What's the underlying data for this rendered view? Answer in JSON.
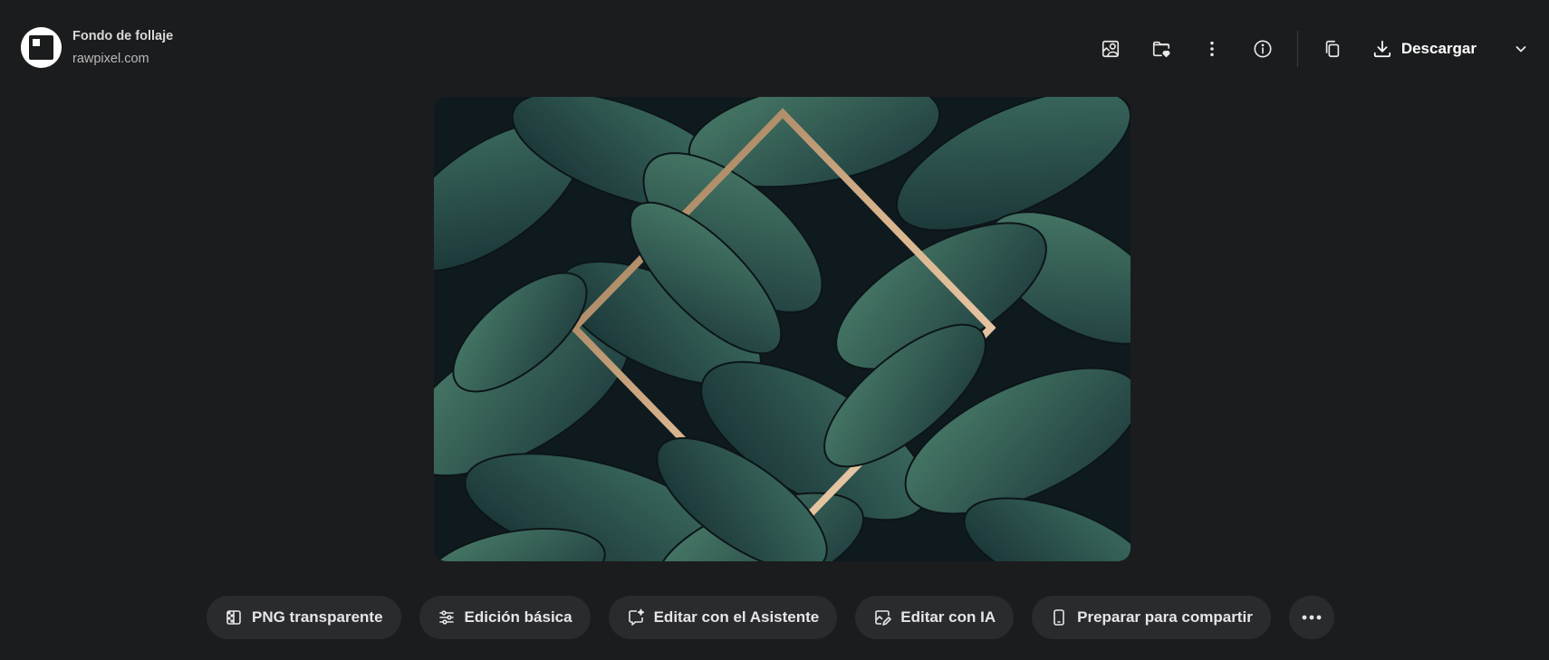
{
  "header": {
    "title": "Fondo de follaje",
    "source": "rawpixel.com",
    "download_label": "Descargar",
    "icons": [
      "user-image-icon",
      "folder-heart-icon",
      "more-vertical-icon",
      "info-icon",
      "copy-icon",
      "download-icon",
      "chevron-down-icon"
    ]
  },
  "preview": {
    "colors": {
      "background": "#0f1a1f",
      "leaf_dark": "#1d3a3c",
      "leaf_mid": "#2e5a55",
      "leaf_light": "#4a7d6a",
      "frame_gold": "#c9a47c"
    }
  },
  "actions": {
    "items": [
      {
        "label": "PNG transparente",
        "icon": "transparent-png-icon"
      },
      {
        "label": "Edición básica",
        "icon": "sliders-icon"
      },
      {
        "label": "Editar con el Asistente",
        "icon": "chat-sparkle-icon"
      },
      {
        "label": "Editar con IA",
        "icon": "image-edit-icon"
      },
      {
        "label": "Preparar para compartir",
        "icon": "phone-icon"
      }
    ],
    "more_icon": "more-horizontal-icon"
  },
  "colors": {
    "page_bg": "#1b1c1e",
    "pill_bg": "#2a2b2e",
    "text": "#e6e6e6"
  }
}
